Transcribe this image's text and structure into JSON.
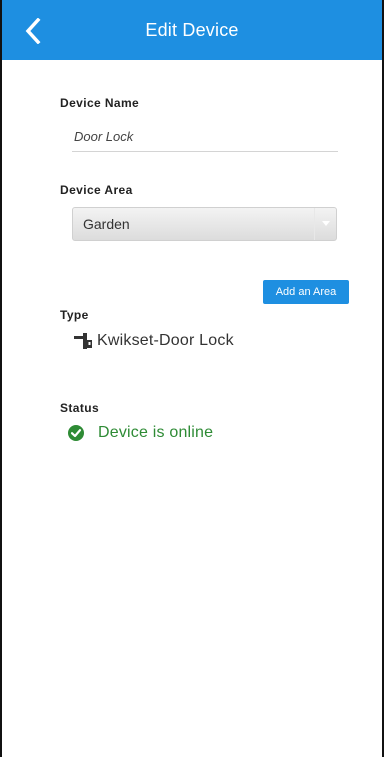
{
  "header": {
    "title": "Edit Device",
    "back_icon": "chevron-left-icon",
    "bg_color": "#1e8fe1"
  },
  "device_name": {
    "label": "Device Name",
    "value": "Door Lock"
  },
  "device_area": {
    "label": "Device Area",
    "selected": "Garden"
  },
  "add_area_button": {
    "label": "Add an Area"
  },
  "type": {
    "label": "Type",
    "value": "Kwikset-Door Lock",
    "icon": "door-lock-icon"
  },
  "status": {
    "label": "Status",
    "value": "Device is online",
    "icon": "check-circle-icon",
    "color": "#2e8b35"
  }
}
